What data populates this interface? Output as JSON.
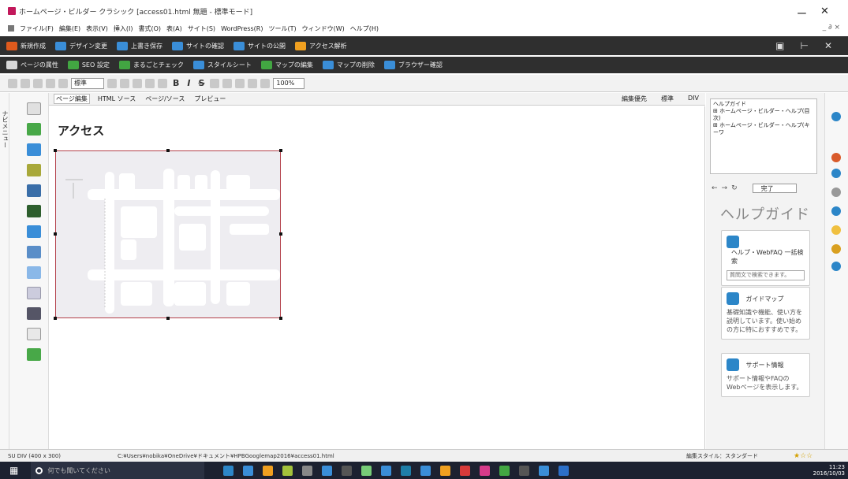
{
  "window": {
    "title": "ホームページ・ビルダー クラシック [access01.html 無題 - 標準モード]",
    "controls": [
      "ー",
      "✕"
    ]
  },
  "menubar": {
    "items": [
      "ファイル(F)",
      "編集(E)",
      "表示(V)",
      "挿入(I)",
      "書式(O)",
      "表(A)",
      "サイト(S)",
      "WordPress(R)",
      "ツール(T)",
      "ウィンドウ(W)",
      "ヘルプ(H)"
    ],
    "right": "_ ∂ ×"
  },
  "toolbar1": {
    "items": [
      "新規作成",
      "デザイン変更",
      "上書き保存",
      "サイトの確認",
      "サイトの公開",
      "アクセス解析"
    ],
    "colors": [
      "#e05a1d",
      "#3a8ed8",
      "#3a8ed8",
      "#3a8ed8",
      "#3a8ed8",
      "#f0a020"
    ]
  },
  "toolbar2": {
    "items": [
      "ページの属性",
      "SEO 設定",
      "まるごとチェック",
      "スタイルシート",
      "マップの編集",
      "マップの削除",
      "ブラウザー確認"
    ],
    "colors": [
      "#d7d7d7",
      "#42a642",
      "#42a642",
      "#3a8ed8",
      "#42a642",
      "#3a8ed8",
      "#3a8ed8"
    ]
  },
  "fmtbar": {
    "style_select": "標準",
    "bold": "B",
    "italic": "I",
    "strike": "S",
    "zoom": "100%"
  },
  "leftrail": {
    "nav_tab": "ナビメニュー"
  },
  "tabs": {
    "items": [
      "ページ編集",
      "HTML ソース",
      "ページ/ソース",
      "プレビュー"
    ],
    "active": 0,
    "right": [
      "編集優先",
      "標準",
      "DIV"
    ]
  },
  "editor": {
    "heading": "アクセス",
    "map_alt": "map"
  },
  "help": {
    "tree": [
      "ヘルプガイド",
      "⊞ ホームページ・ビルダー・ヘルプ(目次)",
      "⊞ ホームページ・ビルダー・ヘルプ(キーワ"
    ],
    "nav_done": "完了",
    "title": "ヘルプガイド",
    "cards": [
      {
        "title": "ヘルプ・WebFAQ 一括検索",
        "search_placeholder": "質問文で検索できます。"
      },
      {
        "title": "ガイドマップ",
        "desc": "基礎知識や機能、使い方を説明しています。使い始めの方に特におすすめです。"
      },
      {
        "title": "サポート情報",
        "desc": "サポート情報やFAQの Webページを表示します。"
      }
    ]
  },
  "statusbar": {
    "left": "SU DIV (400 x 300)",
    "path": "C:¥Users¥nobika¥OneDrive¥ドキュメント¥HPBGooglemap2016¥access01.html",
    "style": "編集スタイル：スタンダード",
    "stars": "★☆☆"
  },
  "taskbar": {
    "search_placeholder": "何でも聞いてください",
    "time": "11:23",
    "date": "2016/10/03",
    "icon_colors": [
      "#2c86c8",
      "#3a8ed8",
      "#f0a020",
      "#a3c23b",
      "#888",
      "#3a8ed8",
      "#555",
      "#7c7",
      "#3a8ed8",
      "#1e7ea8",
      "#3a8ed8",
      "#f0a020",
      "#d73a3a",
      "#d63b8a",
      "#42a642",
      "#555",
      "#3a8ed8",
      "#2c6fc8"
    ]
  }
}
